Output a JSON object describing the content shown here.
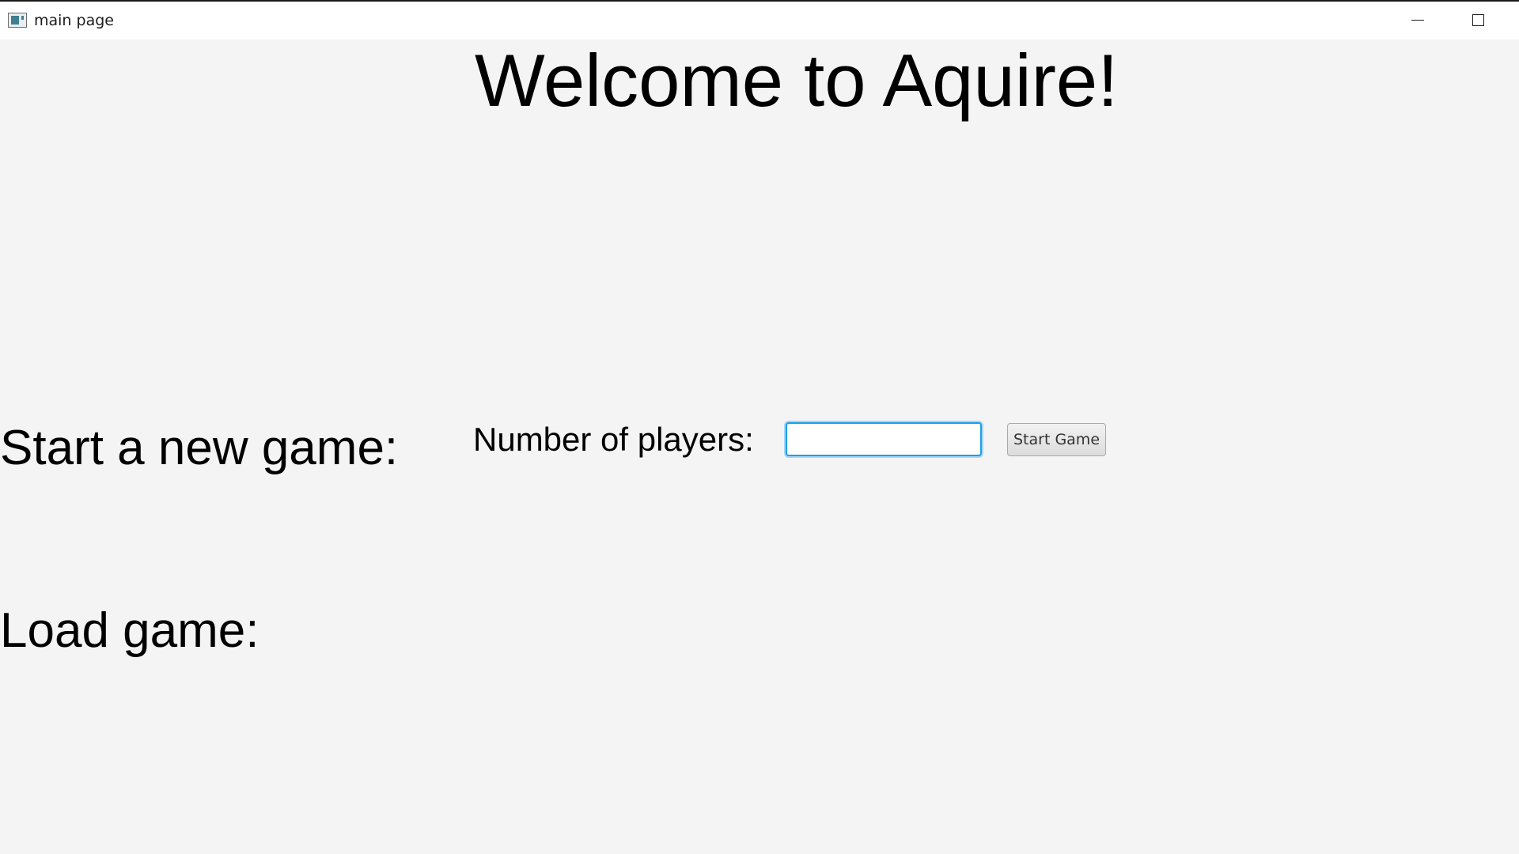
{
  "window": {
    "title": "main page",
    "icon": "app-window-icon",
    "controls": {
      "minimize_icon": "minimize-icon",
      "maximize_icon": "maximize-icon"
    }
  },
  "main": {
    "title": "Welcome to Aquire!",
    "new_game": {
      "heading": "Start a new game:",
      "players_label": "Number of players:",
      "players_input_value": "",
      "start_button_label": "Start Game"
    },
    "load_game": {
      "heading": "Load game:"
    }
  },
  "colors": {
    "background": "#f4f4f4",
    "titlebar": "#ffffff",
    "input_focus_border": "#1e9ee6",
    "text": "#000000"
  }
}
